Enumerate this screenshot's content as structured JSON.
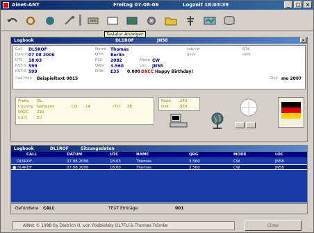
{
  "window": {
    "title": "Ainet-ANT",
    "title_mid": "Freitag 07-08-06",
    "title_right": "Logzeit 18:03:39"
  },
  "toolbar": {
    "tooltip": "Tastatur Anzeigen"
  },
  "logpanel": {
    "title": "Logbook",
    "title_mid": "DL1ROF",
    "title_right": "JN58"
  },
  "qso": {
    "call_label": "Call",
    "call_value": "DL5ROF",
    "name_label": "Name",
    "name_value": "Thomas",
    "qth_label": "QTH",
    "qth_value": "Berlin",
    "zip_label": "PLZ",
    "zip_value": "2082",
    "date_label": "Datum",
    "date_value": "07 08 2006",
    "utc_label": "UTC",
    "utc_value": "18:03",
    "freq_label": "QRG",
    "freq_value": "3.560",
    "mode_label": "Mode",
    "mode_value": "CW",
    "rst_s_label": "RST-S",
    "rst_s_value": "599",
    "rst_r_label": "RST-R",
    "rst_r_value": "599",
    "loc_label": "Loc",
    "loc_value": "JN58",
    "dok_label": "DOK",
    "dok_value": "E35",
    "remark_label": "Call Hist.",
    "remark_value": "Beispieltext 0815",
    "comment_value": "Happy Birthday!",
    "comment_prefix": "0.000",
    "comment_red": "DXCC",
    "right_top_1": "ssb/cw",
    "right_top_2": "qsl/v",
    "right_top_3": "QSL",
    "right_top_4": "sent",
    "right_label": "Day",
    "right_value": "mo 2007"
  },
  "country": {
    "prefix_label": "Prefix",
    "prefix_value": "DL",
    "country_label": "Country",
    "country_value": "Germany",
    "cq_label": "CQ",
    "cq_value": "14",
    "itu_label": "ITU",
    "itu_value": "28",
    "dxcc_label": "DXCC",
    "dxcc_value": "230",
    "cont_label": "Cont",
    "cont_value": "EU",
    "bearing_label": "Richt",
    "bearing_value": "240",
    "dist_label": "Dist",
    "dist_value": "550"
  },
  "logbook": {
    "title": "Logbook",
    "title_call": "DL1ROF",
    "title_info": "Sitzungsdaten",
    "columns": [
      "CALL",
      "DATUM",
      "UTC",
      "NAME",
      "QRG",
      "MODE",
      "LOC"
    ],
    "rows": [
      {
        "call": "DL5ROF",
        "date": "07.08.2006",
        "utc": "18:03",
        "name": "Thomas",
        "qrg": "3.560",
        "mode": "CW",
        "loc": "JN58"
      },
      {
        "call": "DL4RDF",
        "date": "07.08.2006",
        "utc": "18:00",
        "name": "Thomas",
        "qrg": "3.560",
        "mode": "CW",
        "loc": "JN58"
      }
    ],
    "footer_label": "Gefundene",
    "footer_call": "CALL",
    "footer_count_label": "TEXT Einträge",
    "footer_count": "001"
  },
  "statusbar": {
    "text": "AINet © 1998 by Dietrich H. von Podbielsky DL7FU & Thomas Frömke",
    "button": "Close"
  }
}
